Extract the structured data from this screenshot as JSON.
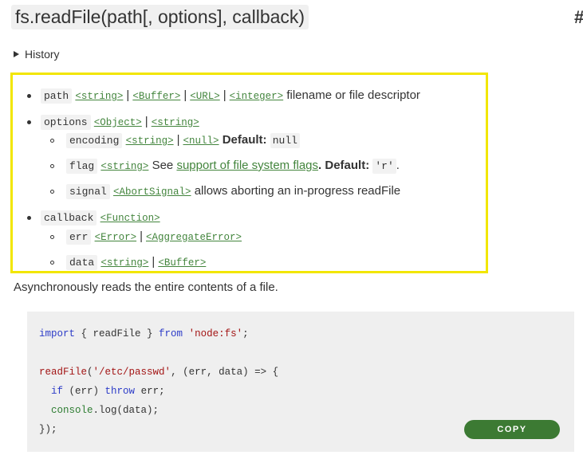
{
  "heading": {
    "title": "fs.readFile(path[, options], callback)",
    "anchor": "#"
  },
  "history": {
    "label": "History",
    "icon": "triangle-right-icon"
  },
  "params": {
    "path": {
      "name": "path",
      "types": [
        "<string>",
        "<Buffer>",
        "<URL>",
        "<integer>"
      ],
      "desc": "filename or file descriptor"
    },
    "options": {
      "name": "options",
      "types": [
        "<Object>",
        "<string>"
      ],
      "encoding": {
        "name": "encoding",
        "types": [
          "<string>",
          "<null>"
        ],
        "default_label": "Default:",
        "default_value": "null"
      },
      "flag": {
        "name": "flag",
        "types": [
          "<string>"
        ],
        "see": "See",
        "link": "support of file system flags",
        "default_label": ". Default:",
        "default_value": "'r'",
        "end": "."
      },
      "signal": {
        "name": "signal",
        "types": [
          "<AbortSignal>"
        ],
        "desc": "allows aborting an in-progress readFile"
      }
    },
    "callback": {
      "name": "callback",
      "types": [
        "<Function>"
      ],
      "err": {
        "name": "err",
        "types": [
          "<Error>",
          "<AggregateError>"
        ]
      },
      "data": {
        "name": "data",
        "types": [
          "<string>",
          "<Buffer>"
        ]
      }
    }
  },
  "description": "Asynchronously reads the entire contents of a file.",
  "code": {
    "l1": {
      "kw1": "import",
      "mid": " { readFile } ",
      "kw2": "from",
      "sp": " ",
      "str": "'node:fs'",
      "end": ";"
    },
    "l3": {
      "fn": "readFile",
      "open": "(",
      "str": "'/etc/passwd'",
      "rest": ", (err, data) => {"
    },
    "l4": {
      "indent": "  ",
      "kw1": "if",
      "mid": " (err) ",
      "kw2": "throw",
      "end": " err;"
    },
    "l5": {
      "indent": "  ",
      "obj": "console",
      "rest": ".log(data);"
    },
    "l6": {
      "text": "});"
    },
    "copy_label": "COPY"
  }
}
